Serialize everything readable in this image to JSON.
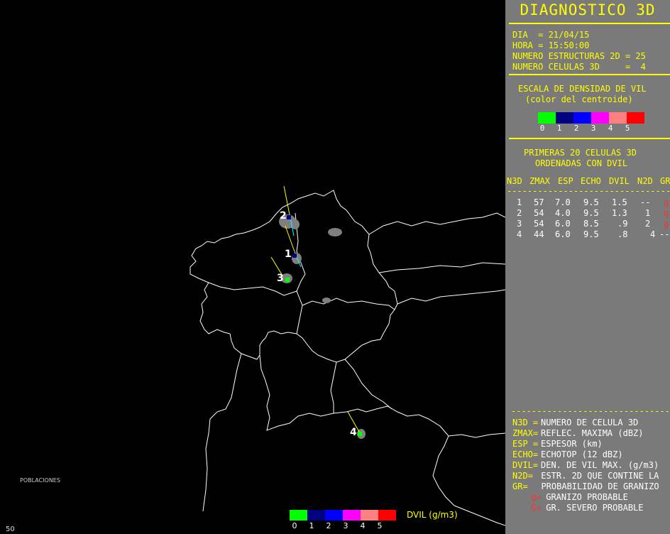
{
  "title": "DIAGNOSTICO 3D",
  "info": {
    "dia_line": "DIA  = 21/04/15",
    "hora_line": "HORA = 15:50:00",
    "estructuras_line": "NUMERO ESTRUCTURAS 2D = 25",
    "celulas_line": "NUMERO CELULAS 3D     =  4"
  },
  "vil_scale": {
    "title": "ESCALA DE DENSIDAD DE VIL",
    "subtitle": "(color del centroide)",
    "colors": [
      "#00ff00",
      "#000080",
      "#0000ff",
      "#ff00ff",
      "#ff8080",
      "#ff0000"
    ],
    "labels": [
      "0",
      "1",
      "2",
      "3",
      "4",
      "5"
    ]
  },
  "ranking": {
    "title_1": "PRIMERAS 20 CELULAS 3D",
    "title_2": "ORDENADAS CON DVIL",
    "columns": [
      "N3D",
      "ZMAX",
      "ESP",
      "ECHO",
      "DVIL",
      "N2D",
      "GR"
    ],
    "dashes": "------------------------------------",
    "rows": [
      {
        "n3d": "1",
        "zmax": "57",
        "esp": "7.0",
        "echo": "9.5",
        "dvil": "1.5",
        "n2d": "--",
        "gr": "g"
      },
      {
        "n3d": "2",
        "zmax": "54",
        "esp": "4.0",
        "echo": "9.5",
        "dvil": "1.3",
        "n2d": "1",
        "gr": "g"
      },
      {
        "n3d": "3",
        "zmax": "54",
        "esp": "6.0",
        "echo": "8.5",
        "dvil": ".9",
        "n2d": "2",
        "gr": "g"
      },
      {
        "n3d": "4",
        "zmax": "44",
        "esp": "6.0",
        "echo": "9.5",
        "dvil": ".8",
        "n2d": "4",
        "gr": "--"
      }
    ]
  },
  "glossary": {
    "dashes": "------------------------------------",
    "items": [
      {
        "key": "N3D =",
        "text": "NUMERO DE CELULA 3D"
      },
      {
        "key": "ZMAX=",
        "text": "REFLEC. MAXIMA (dBZ)"
      },
      {
        "key": "ESP =",
        "text": "ESPESOR (km)"
      },
      {
        "key": "ECHO=",
        "text": "ECHOTOP (12 dBZ)"
      },
      {
        "key": "DVIL=",
        "text": "DEN. DE VIL MAX. (g/m3)"
      },
      {
        "key": "N2D=",
        "text": " ESTR. 2D QUE CONTINE LA"
      },
      {
        "key": "GR=",
        "text": "  PROBABILIDAD DE GRANIZO"
      }
    ],
    "hail": [
      {
        "key": "g=",
        "text": " GRANIZO PROBABLE"
      },
      {
        "key": "G=",
        "text": " GR. SEVERO PROBABLE"
      }
    ]
  },
  "map": {
    "cells": [
      {
        "label": "1",
        "color": "#000080"
      },
      {
        "label": "2",
        "color": "#000080"
      },
      {
        "label": "3",
        "color": "#00ff00"
      },
      {
        "label": "4",
        "color": "#00ff00"
      }
    ],
    "poblaciones": "POBLACIONES",
    "corner_value": "50",
    "legend_colors": [
      "#00ff00",
      "#000080",
      "#0000ff",
      "#ff00ff",
      "#ff8080",
      "#ff0000"
    ],
    "legend_labels": [
      "0",
      "1",
      "2",
      "3",
      "4",
      "5"
    ],
    "legend_unit": "DVIL (g/m3)"
  }
}
